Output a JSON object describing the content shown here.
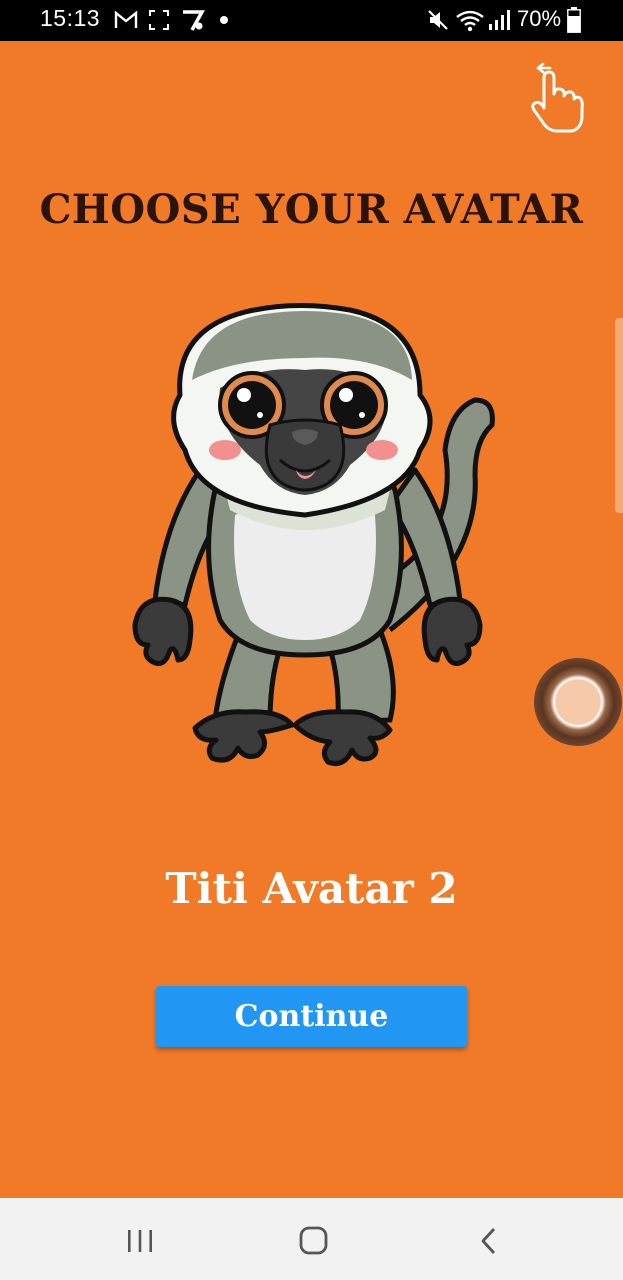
{
  "status_bar": {
    "time": "15:13",
    "battery": "70%",
    "icons": [
      "gmail-icon",
      "screenshot-icon",
      "app-icon",
      "dot-icon",
      "mute-icon",
      "wifi-icon",
      "signal-icon",
      "battery-icon"
    ]
  },
  "screen": {
    "title": "CHOOSE YOUR AVATAR",
    "avatar_name": "Titi Avatar 2",
    "continue_label": "Continue"
  },
  "nav_bar": {
    "icons": [
      "recent-apps-icon",
      "home-icon",
      "back-icon"
    ]
  },
  "colors": {
    "background": "#F07A28",
    "title": "#2A1308",
    "button": "#2196F3",
    "button_text": "#FFFFFF",
    "nav_bar": "#F2F2F2"
  }
}
